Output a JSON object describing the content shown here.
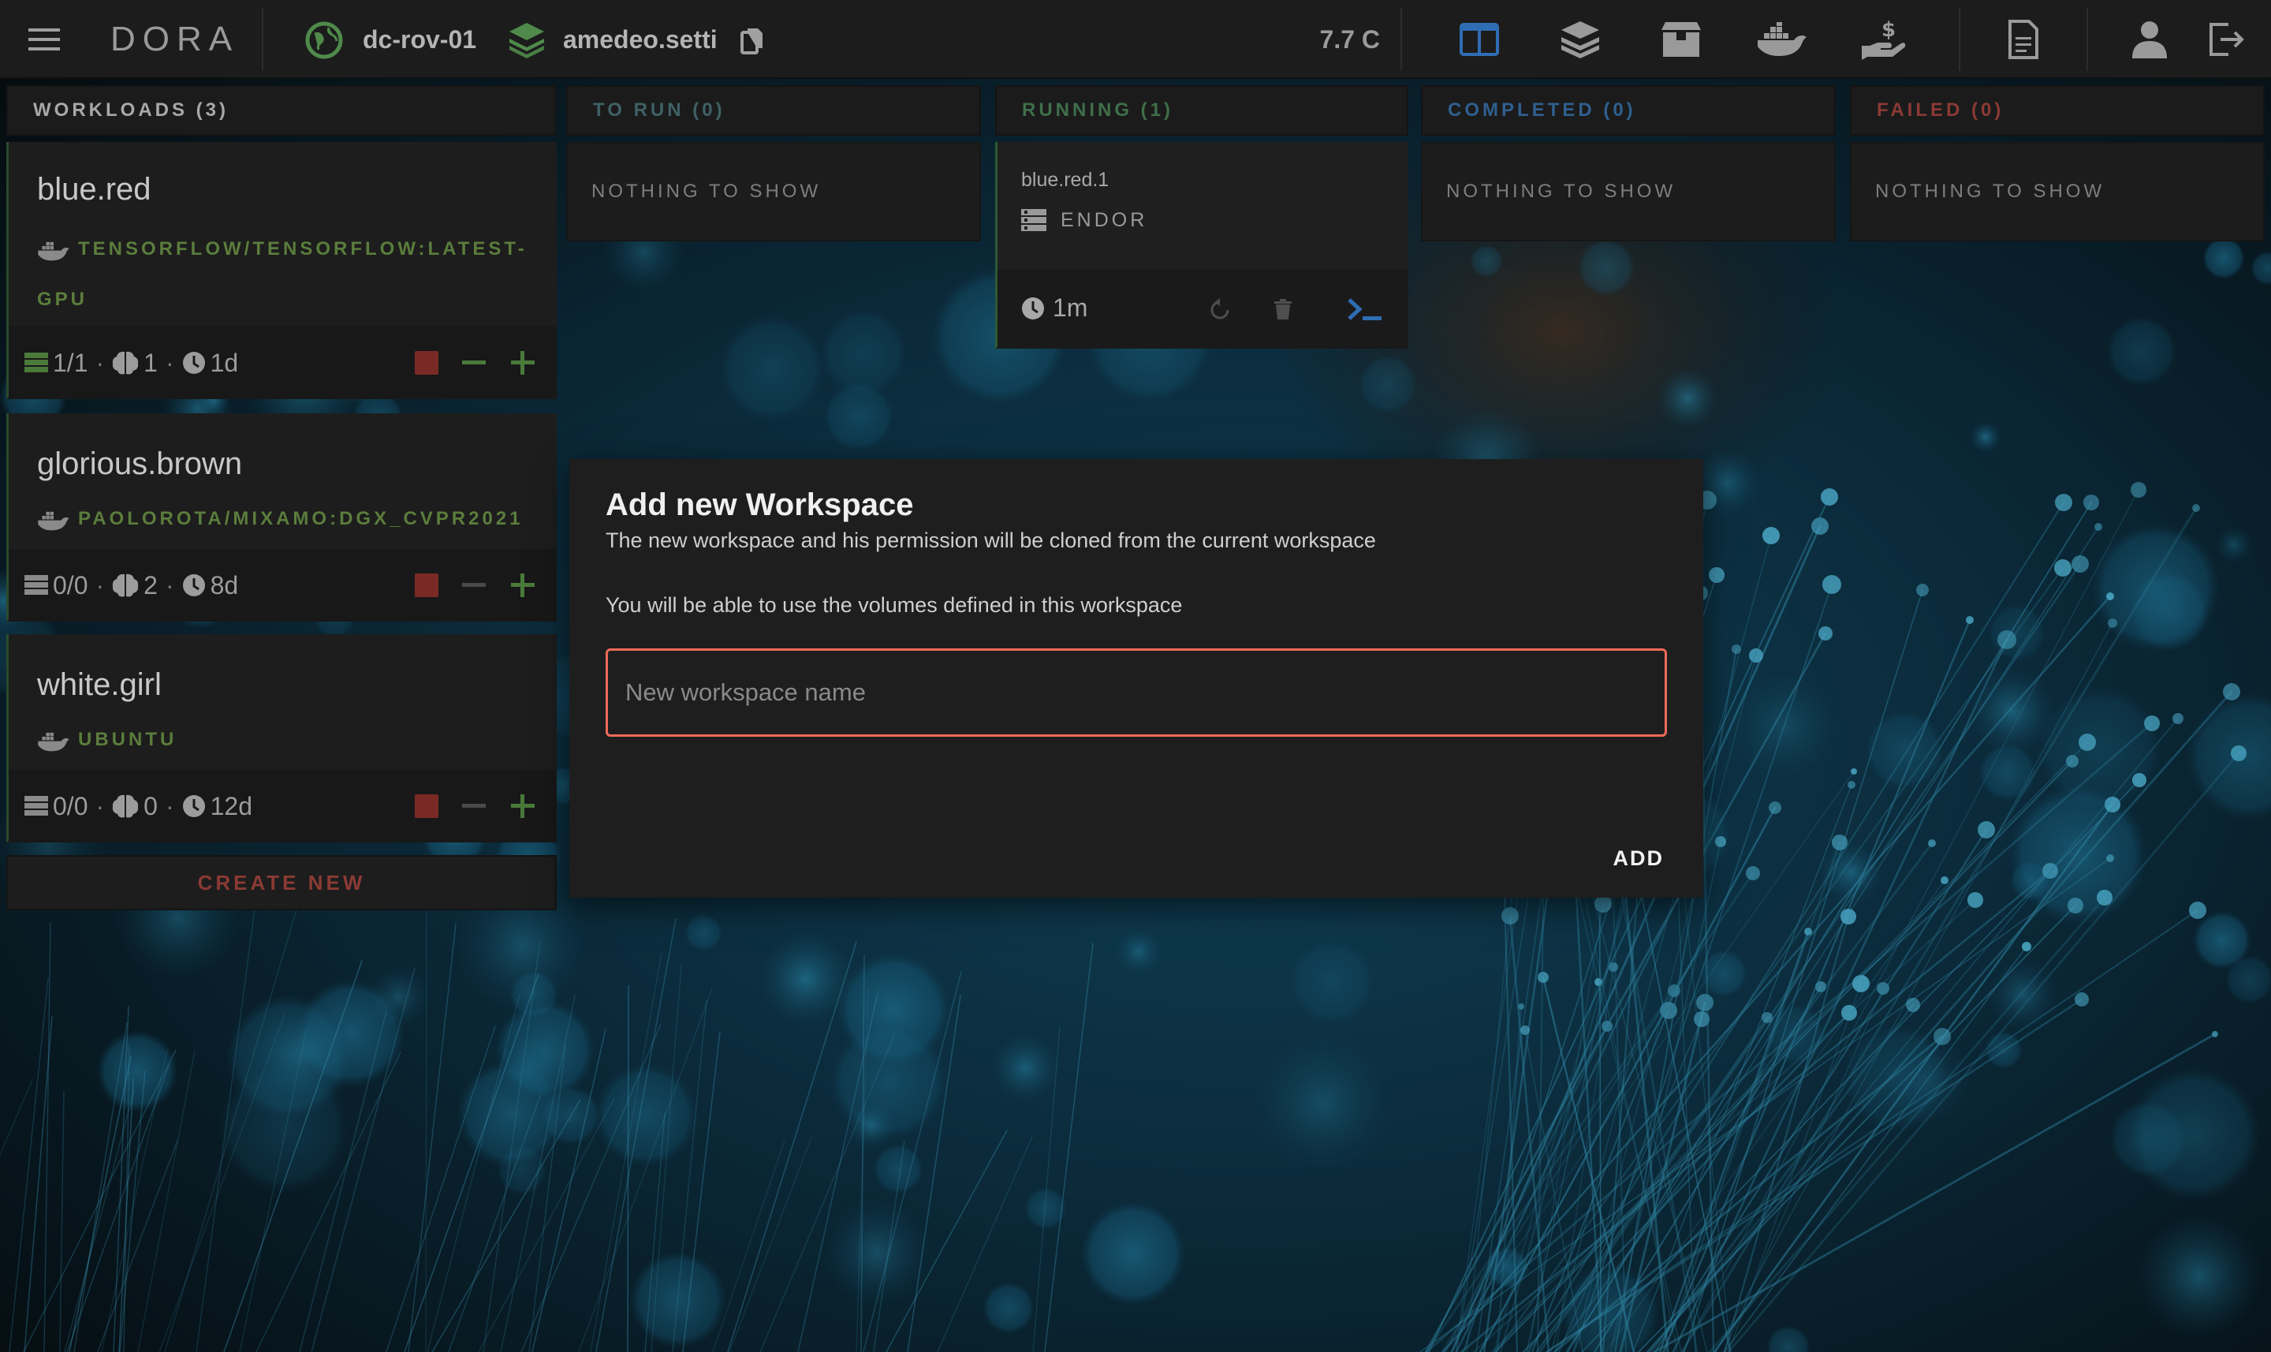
{
  "app": {
    "brand": "DORA",
    "zone": "dc-rov-01",
    "workspace": "amedeo.setti",
    "credits": "7.7 C"
  },
  "nav_icons": [
    "workloads-board-icon",
    "layers-icon",
    "archive-box-icon",
    "docker-icon",
    "pay-hand-icon",
    "document-icon",
    "user-icon",
    "logout-icon"
  ],
  "columns": {
    "workloads": "WORKLOADS (3)",
    "to_run": "TO RUN (0)",
    "running": "RUNNING (1)",
    "completed": "COMPLETED (0)",
    "failed": "FAILED (0)"
  },
  "empty_text": "NOTHING TO SHOW",
  "workloads": [
    {
      "name": "blue.red",
      "image_line1": "TENSORFLOW/TENSORFLOW:LATEST-",
      "image_line2": "GPU",
      "replicas": "1/1",
      "gpus": "1",
      "age": "1d"
    },
    {
      "name": "glorious.brown",
      "image_line1": "PAOLOROTA/MIXAMO:DGX_CVPR2021",
      "replicas": "0/0",
      "gpus": "2",
      "age": "8d"
    },
    {
      "name": "white.girl",
      "image_line1": "UBUNTU",
      "replicas": "0/0",
      "gpus": "0",
      "age": "12d"
    }
  ],
  "create_new": "CREATE NEW",
  "running_card": {
    "name": "blue.red.1",
    "node": "ENDOR",
    "time": "1m"
  },
  "dialog": {
    "title": "Add new Workspace",
    "subtitle": "The new workspace and his permission will be cloned from the current workspace",
    "note": "You will be able to use the volumes defined in this workspace",
    "input_placeholder": "New workspace name",
    "input_value": "",
    "add_label": "ADD"
  },
  "colors": {
    "accent_error": "#f06a5a",
    "running_green": "#3f6f4a",
    "completed_blue": "#2f5f8f",
    "failed_red": "#8b3a34",
    "nav_active": "#2f6db5"
  }
}
